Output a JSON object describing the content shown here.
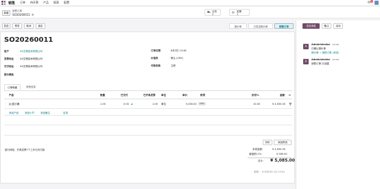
{
  "topbar": {
    "app_name": "销售",
    "menu": [
      "订单",
      "待开票",
      "产品",
      "报表",
      "配置"
    ],
    "notif_count": "2"
  },
  "control": {
    "new": "新建",
    "breadcrumb": "销售订单",
    "record": "SO20260011",
    "smart": [
      {
        "label": "交货",
        "count": "1"
      },
      {
        "label": "发票",
        "count": "1"
      }
    ]
  },
  "actions": [
    "发送",
    "预览",
    "取消",
    "锁定"
  ],
  "stages": [
    "报价单",
    "已发送报价单",
    "销售订单"
  ],
  "form": {
    "title": "SO20260011",
    "fields_left": [
      {
        "label": "客户",
        "value": "XX文物技术有限公司"
      },
      {
        "label": "发票地址",
        "value": "XX文物技术有限公司"
      },
      {
        "label": "交付地址",
        "value": "XX文物技术有限公司"
      },
      {
        "label": "报价模板",
        "value": ""
      }
    ],
    "fields_right": [
      {
        "label": "订单日期",
        "value": "6月3日 13:46"
      },
      {
        "label": "价格表",
        "value": "默认 (CNY)"
      },
      {
        "label": "付款条款",
        "value": "立即"
      }
    ]
  },
  "tabs": [
    "订单明细",
    "其他信息"
  ],
  "table": {
    "headers": [
      "产品",
      "数量",
      "已交付",
      "已开具发票",
      "单位",
      "单价",
      "税项",
      "折扣%",
      "金额"
    ],
    "row": {
      "product": "[JJ]显示器",
      "qty": "1.00",
      "delivered": "0.00",
      "invoiced": "1.00",
      "uom": "单位",
      "price": "5,000.00",
      "tax": "13%",
      "disc": "10.00",
      "amount": "¥ 4,500.00"
    }
  },
  "add_links": [
    "添加产品",
    "添加小节",
    "添加备注",
    "目录"
  ],
  "summary_buttons": [
    "折扣",
    "添加物流"
  ],
  "terms": "银行转账，开具发票7个工作日内付款",
  "totals": {
    "untaxed_label": "未税金额:",
    "untaxed": "¥ 4,500.00",
    "tax_label": "增值税13%",
    "tax": "¥ 585.00",
    "total_label": "总计:",
    "total": "¥ 5,085.00",
    "margin_label": "毛利:",
    "margin": "¥ 500.00 (11.11%)"
  },
  "chatter": {
    "buttons": [
      "发送消息",
      "备注",
      "活动"
    ],
    "messages": [
      {
        "author": "Administrator",
        "time": "13:46",
        "line1": "已确认报价单",
        "line2": "报价单 → 销售订单 (状态)"
      },
      {
        "author": "Administrator",
        "time": "13:46",
        "line1": "销售订单 已创建",
        "line2": ""
      }
    ]
  }
}
